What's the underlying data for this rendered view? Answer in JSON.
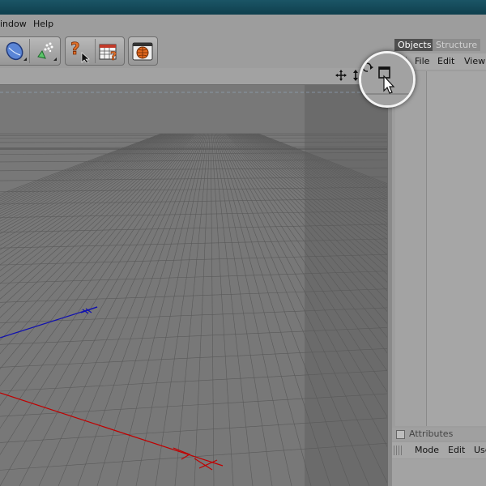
{
  "menubar": {
    "items": [
      "indow",
      "Help"
    ]
  },
  "toolbar": {
    "icons": [
      "deformer-icon",
      "particles-icon",
      "help-pointer-icon",
      "help-table-icon",
      "render-globe-icon"
    ]
  },
  "viewport": {
    "header_icons": [
      "move-view-icon",
      "zoom-view-icon",
      "rotate-view-icon",
      "maximize-view-icon"
    ]
  },
  "right_panel": {
    "tabs": [
      {
        "label": "Objects",
        "active": true
      },
      {
        "label": "Structure",
        "active": false
      }
    ],
    "menu": [
      "File",
      "Edit",
      "View"
    ],
    "attributes": {
      "title": "Attributes",
      "menu": [
        "Mode",
        "Edit",
        "Use"
      ]
    }
  },
  "colors": {
    "titlebar": "#0f3f4d",
    "axis_x": "#c00000",
    "axis_z": "#1010b0"
  }
}
